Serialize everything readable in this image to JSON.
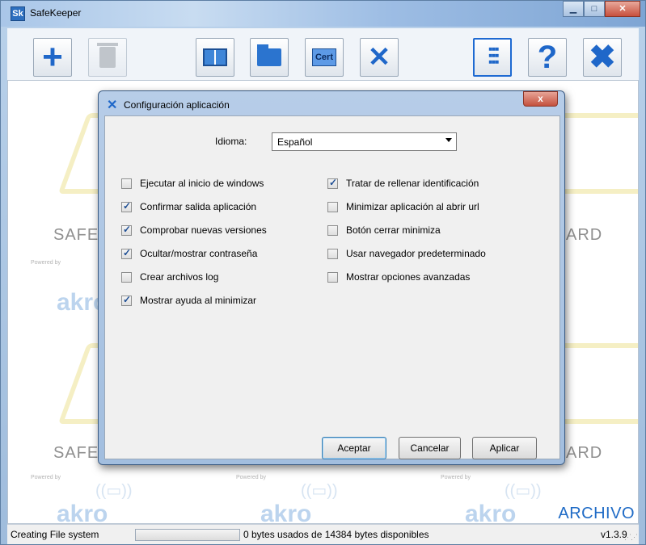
{
  "window": {
    "title": "SafeKeeper",
    "app_icon": "Sk"
  },
  "window_controls": {
    "minimize": "▁",
    "maximize": "□",
    "close": "✕"
  },
  "toolbar": {
    "buttons": [
      {
        "icon": "plus-icon"
      },
      {
        "icon": "trash-icon"
      },
      {
        "icon": "book-icon"
      },
      {
        "icon": "folder-icon"
      },
      {
        "icon": "cert-icon",
        "label": "Cert"
      },
      {
        "icon": "tools-icon"
      },
      {
        "icon": "sliders-icon"
      },
      {
        "icon": "help-icon",
        "label": "?"
      },
      {
        "icon": "close-icon",
        "label": "✖"
      }
    ]
  },
  "watermark": {
    "safe": "SAFE",
    "ard": "ARD",
    "powered": "Powered by",
    "akro": "akro",
    "archivo": "ARCHIVO"
  },
  "status": {
    "left": "Creating File system",
    "usage": "0 bytes usados de 14384 bytes disponibles",
    "version": "v1.3.9"
  },
  "dialog": {
    "title": "Configuración aplicación",
    "close": "x",
    "language_label": "Idioma:",
    "language_value": "Español",
    "left_options": [
      {
        "label": "Ejecutar al inicio de windows",
        "checked": false
      },
      {
        "label": "Confirmar salida aplicación",
        "checked": true
      },
      {
        "label": "Comprobar nuevas versiones",
        "checked": true
      },
      {
        "label": "Ocultar/mostrar contraseña",
        "checked": true
      },
      {
        "label": "Crear archivos log",
        "checked": false
      },
      {
        "label": "Mostrar ayuda al minimizar",
        "checked": true
      }
    ],
    "right_options": [
      {
        "label": "Tratar de rellenar identificación",
        "checked": true
      },
      {
        "label": "Minimizar aplicación al abrir url",
        "checked": false
      },
      {
        "label": "Botón cerrar minimiza",
        "checked": false
      },
      {
        "label": "Usar navegador predeterminado",
        "checked": false
      },
      {
        "label": "Mostrar opciones avanzadas",
        "checked": false
      }
    ],
    "buttons": {
      "accept": "Aceptar",
      "cancel": "Cancelar",
      "apply": "Aplicar"
    }
  }
}
